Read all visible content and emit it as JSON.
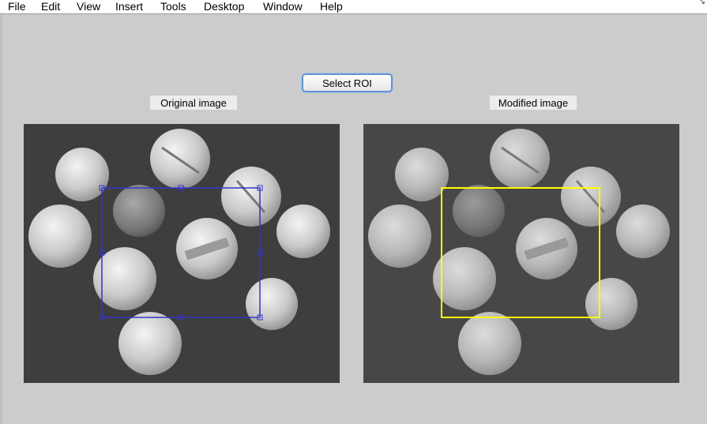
{
  "menubar": {
    "items": [
      "File",
      "Edit",
      "View",
      "Insert",
      "Tools",
      "Desktop",
      "Window",
      "Help"
    ]
  },
  "button": {
    "label": "Select ROI"
  },
  "labels": {
    "original": "Original image",
    "modified": "Modified image"
  },
  "colors": {
    "roi_original": "#3333cc",
    "roi_modified": "#ffff00",
    "figure_bg": "#cccccc"
  },
  "icons": {
    "corner": "resize-arrow-icon"
  }
}
